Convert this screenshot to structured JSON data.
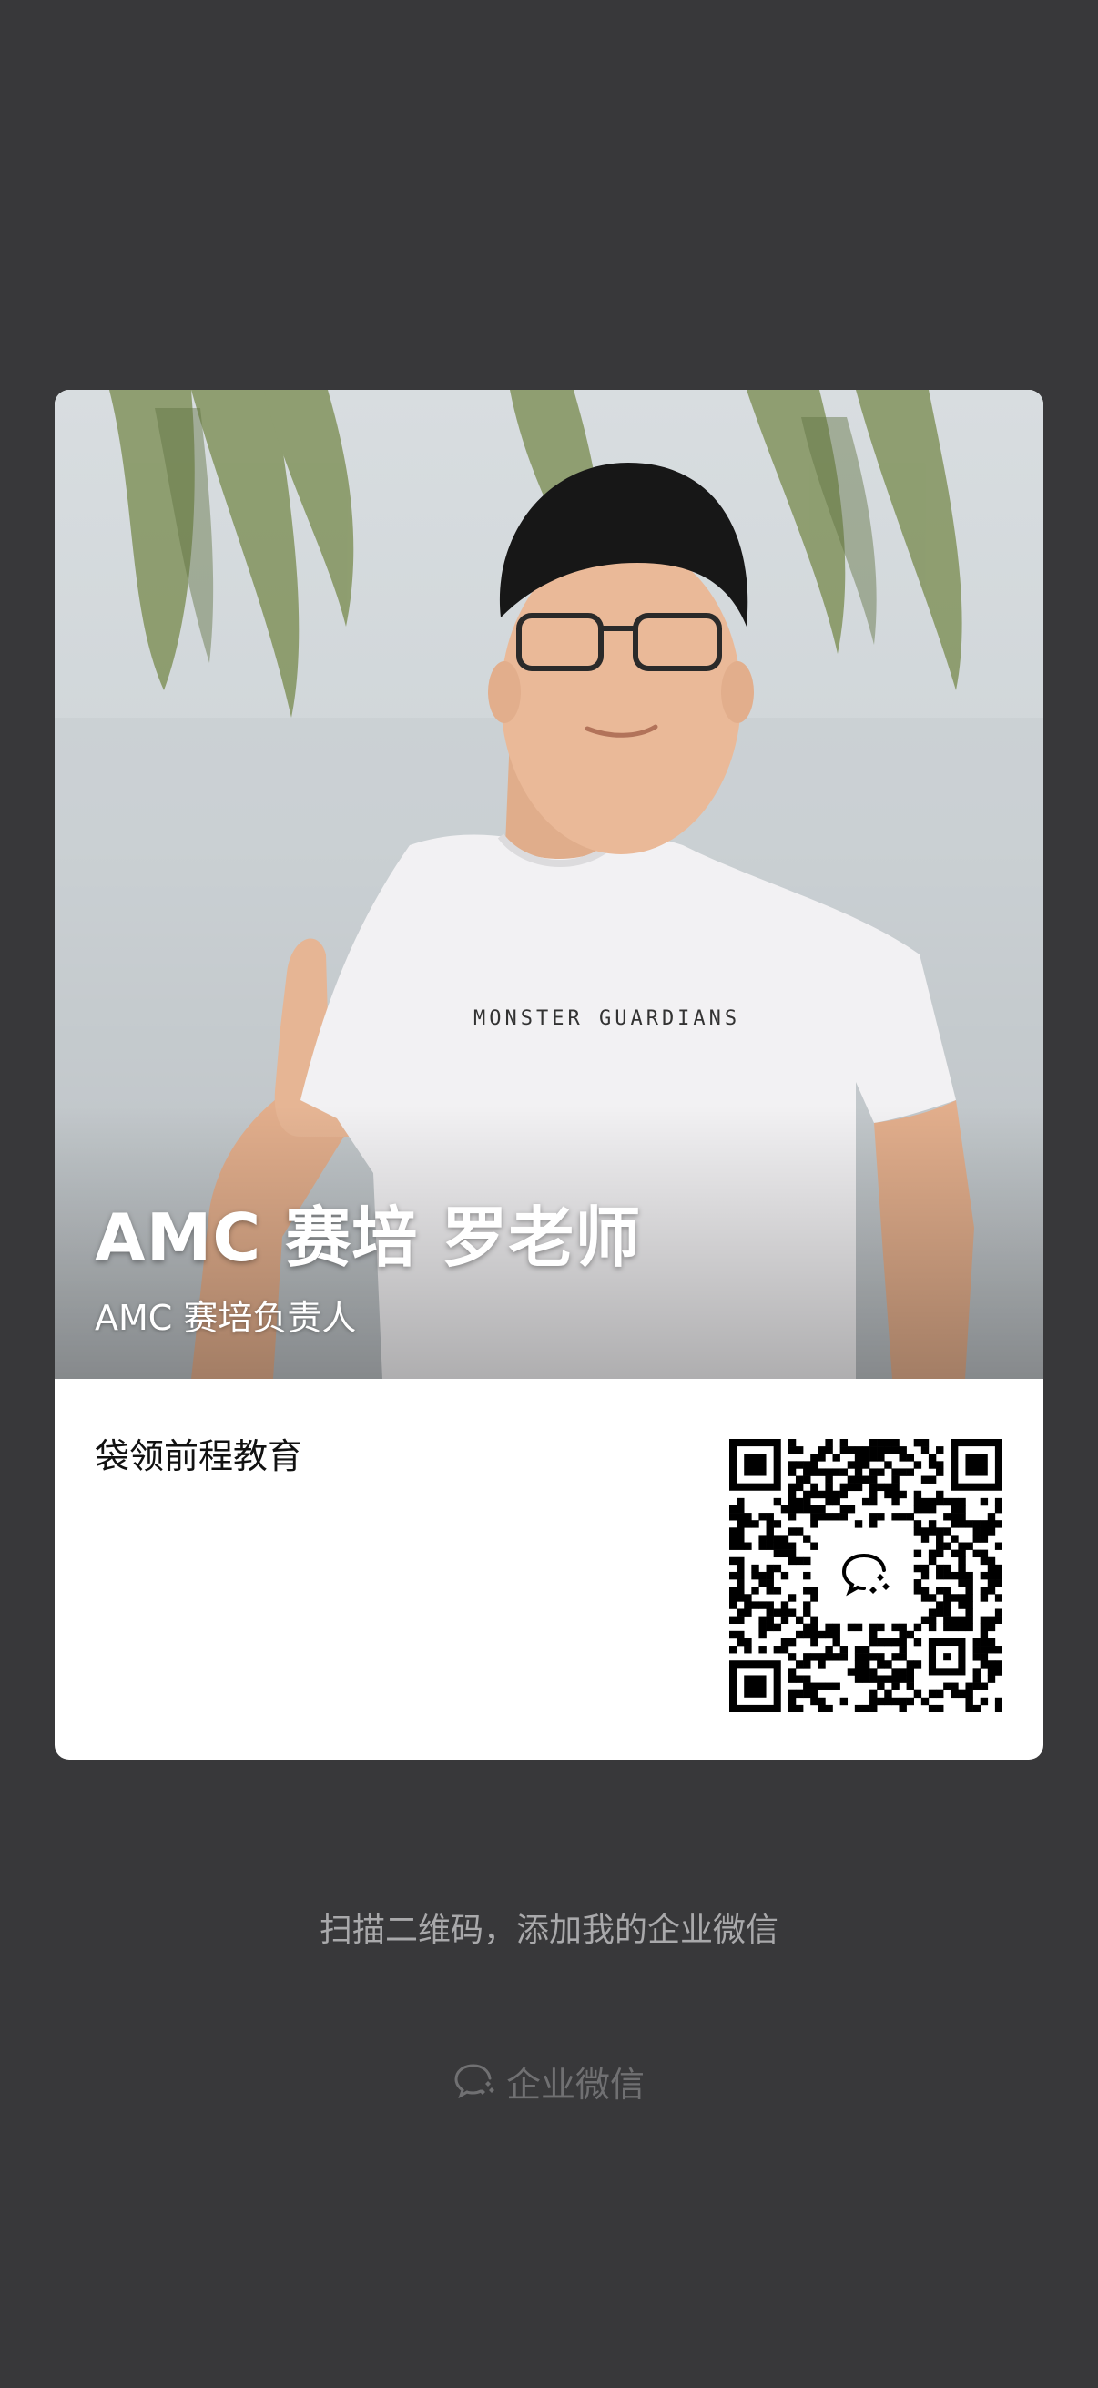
{
  "card": {
    "name": "AMC 赛培 罗老师",
    "position": "AMC 赛培负责人",
    "company": "袋领前程教育",
    "shirt_text": "MONSTER GUARDIANS"
  },
  "footer": {
    "scan_hint": "扫描二维码，添加我的企业微信",
    "brand": "企业微信",
    "brand_icon": "wecom-logo-icon"
  },
  "colors": {
    "background": "#38383a",
    "card": "#ffffff",
    "hint_text": "#a9a9ab",
    "brand_text": "#707072"
  }
}
